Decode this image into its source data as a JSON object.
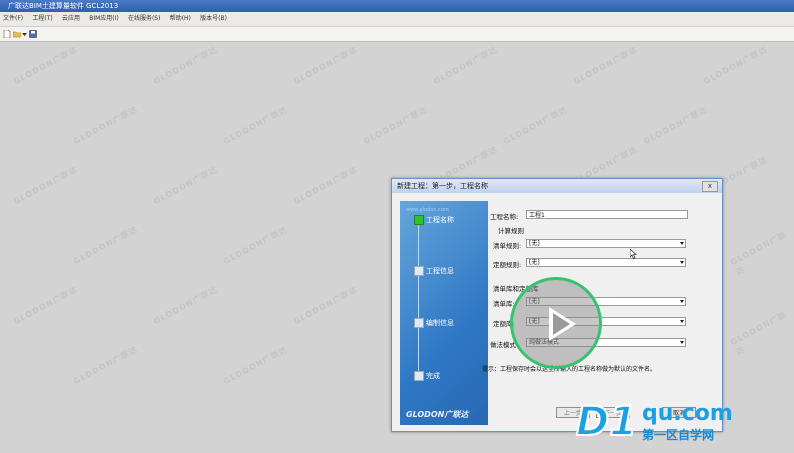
{
  "app": {
    "title": "广联达BIM土建算量软件 GCL2013"
  },
  "menu": [
    "文件(F)",
    "工程(T)",
    "云应用",
    "BIM应用(I)",
    "在线服务(S)",
    "帮助(H)",
    "版本号(B)"
  ],
  "toolbar": {
    "icons": [
      "new-file-icon",
      "open-folder-icon",
      "dropdown-arrow-icon",
      "save-icon"
    ]
  },
  "watermark": "GLODON广联达",
  "dialog": {
    "title": "新建工程：第一步，工程名称",
    "close": "x",
    "sidebar": {
      "url": "www.glodon.com",
      "steps": [
        {
          "label": "工程名称",
          "active": true
        },
        {
          "label": "工程信息",
          "active": false
        },
        {
          "label": "编制信息",
          "active": false
        },
        {
          "label": "完成",
          "active": false
        }
      ],
      "brand": "GLODON广联达"
    },
    "form": {
      "project_name_label": "工程名称:",
      "project_name_value": "工程1",
      "calc_rules_heading": "计算规则",
      "list_rule_label": "清单规则:",
      "list_rule_value": "[无]",
      "quota_rule_label": "定额规则:",
      "quota_rule_value": "[无]",
      "library_heading": "清单库和定额库",
      "list_lib_label": "清单库:",
      "list_lib_value": "[无]",
      "quota_lib_label": "定额库:",
      "quota_lib_value": "[无]",
      "mode_label": "做法模式:",
      "mode_value": "纯做法模式",
      "hint": "提示：工程保存时会以这里所输入的工程名称做为默认的文件名。"
    },
    "buttons": {
      "prev": "上一步",
      "next": "下一步",
      "cancel": "取消"
    }
  },
  "overlay": {
    "play_icon": "play-icon"
  },
  "logo": {
    "main": "D1",
    "domain": "qu.com",
    "slogan": "第一区自学网"
  }
}
